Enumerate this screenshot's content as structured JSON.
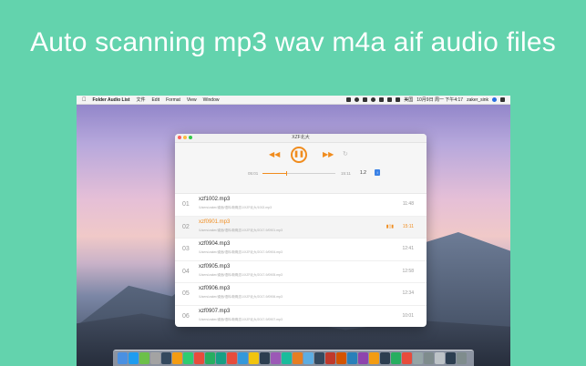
{
  "headline": "Auto scanning mp3 wav m4a aif audio files",
  "menubar": {
    "app_name": "Folder Audio List",
    "menus": [
      "文件",
      "Edit",
      "Format",
      "View",
      "Window"
    ],
    "input_method": "美国",
    "clock": "10月9日 周一 下午4:17",
    "user": "zaker_sink"
  },
  "window": {
    "title": "XZF北大",
    "player": {
      "elapsed": "05:01",
      "total": "15:11",
      "progress": 0.33,
      "rate": "1.2"
    },
    "tracks": [
      {
        "num": "01",
        "name": "xzf1002.mp3",
        "path": "/Users/zaker/桌面/语料/新概念1/XZF北大/1002.mp3",
        "duration": "11:48",
        "active": false
      },
      {
        "num": "02",
        "name": "xzf0901.mp3",
        "path": "/Users/zaker/桌面/语料/新概念1/XZF北大/2017-9/0901.mp3",
        "duration": "15:11",
        "active": true
      },
      {
        "num": "03",
        "name": "xzf0904.mp3",
        "path": "/Users/zaker/桌面/语料/新概念1/XZF北大/2017-9/0904.mp3",
        "duration": "12:41",
        "active": false
      },
      {
        "num": "04",
        "name": "xzf0905.mp3",
        "path": "/Users/zaker/桌面/语料/新概念1/XZF北大/2017-9/0905.mp3",
        "duration": "12:58",
        "active": false
      },
      {
        "num": "05",
        "name": "xzf0906.mp3",
        "path": "/Users/zaker/桌面/语料/新概念1/XZF北大/2017-9/0906.mp3",
        "duration": "12:34",
        "active": false
      },
      {
        "num": "06",
        "name": "xzf0907.mp3",
        "path": "/Users/zaker/桌面/语料/新概念1/XZF北大/2017-9/0907.mp3",
        "duration": "10:01",
        "active": false
      }
    ]
  },
  "colors": {
    "accent": "#f08c1e",
    "background": "#63d3ad",
    "dock_icons": [
      "#4a90e2",
      "#1e9cf0",
      "#6cc04a",
      "#a3a3a3",
      "#34495e",
      "#f39c12",
      "#2ecc71",
      "#e74c3c",
      "#27ae60",
      "#16a085",
      "#e74c3c",
      "#3498db",
      "#f1c40f",
      "#2c3e50",
      "#9b59b6",
      "#1abc9c",
      "#e67e22",
      "#5dade2",
      "#34495e",
      "#c0392b",
      "#d35400",
      "#2980b9",
      "#8e44ad",
      "#f39c12",
      "#2c3e50",
      "#27ae60",
      "#e74c3c",
      "#95a5a6",
      "#7f8c8d",
      "#bdc3c7",
      "#2c3e50",
      "#7f8c8d"
    ]
  }
}
